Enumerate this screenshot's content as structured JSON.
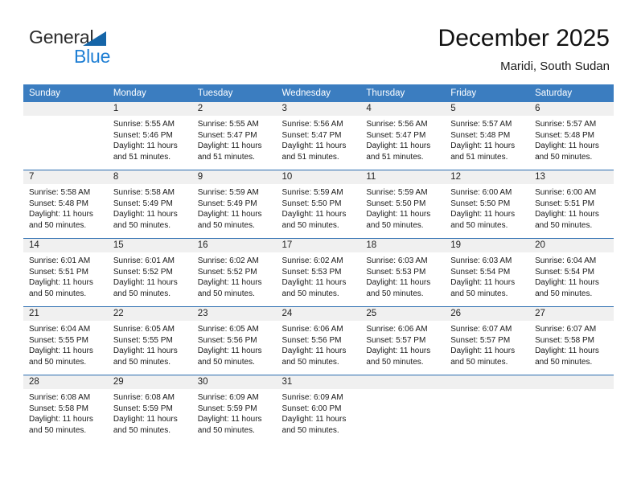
{
  "brand": {
    "name_part1": "General",
    "name_part2": "Blue",
    "flag_icon": "triangle-flag-icon"
  },
  "header": {
    "title": "December 2025",
    "subtitle": "Maridi, South Sudan"
  },
  "theme": {
    "header_blue": "#3b7dc0",
    "rule_blue": "#2a6cb0",
    "daynum_strip": "#f0f0f0",
    "brand_blue": "#1f7fd4",
    "brand_flag_blue": "#1565a8"
  },
  "calendar": {
    "weekday_headers": [
      "Sunday",
      "Monday",
      "Tuesday",
      "Wednesday",
      "Thursday",
      "Friday",
      "Saturday"
    ],
    "weeks": [
      [
        {
          "day": "",
          "sunrise": "",
          "sunset": "",
          "daylight_line1": "",
          "daylight_line2": "",
          "empty": true
        },
        {
          "day": "1",
          "sunrise": "Sunrise: 5:55 AM",
          "sunset": "Sunset: 5:46 PM",
          "daylight_line1": "Daylight: 11 hours",
          "daylight_line2": "and 51 minutes."
        },
        {
          "day": "2",
          "sunrise": "Sunrise: 5:55 AM",
          "sunset": "Sunset: 5:47 PM",
          "daylight_line1": "Daylight: 11 hours",
          "daylight_line2": "and 51 minutes."
        },
        {
          "day": "3",
          "sunrise": "Sunrise: 5:56 AM",
          "sunset": "Sunset: 5:47 PM",
          "daylight_line1": "Daylight: 11 hours",
          "daylight_line2": "and 51 minutes."
        },
        {
          "day": "4",
          "sunrise": "Sunrise: 5:56 AM",
          "sunset": "Sunset: 5:47 PM",
          "daylight_line1": "Daylight: 11 hours",
          "daylight_line2": "and 51 minutes."
        },
        {
          "day": "5",
          "sunrise": "Sunrise: 5:57 AM",
          "sunset": "Sunset: 5:48 PM",
          "daylight_line1": "Daylight: 11 hours",
          "daylight_line2": "and 51 minutes."
        },
        {
          "day": "6",
          "sunrise": "Sunrise: 5:57 AM",
          "sunset": "Sunset: 5:48 PM",
          "daylight_line1": "Daylight: 11 hours",
          "daylight_line2": "and 50 minutes."
        }
      ],
      [
        {
          "day": "7",
          "sunrise": "Sunrise: 5:58 AM",
          "sunset": "Sunset: 5:48 PM",
          "daylight_line1": "Daylight: 11 hours",
          "daylight_line2": "and 50 minutes."
        },
        {
          "day": "8",
          "sunrise": "Sunrise: 5:58 AM",
          "sunset": "Sunset: 5:49 PM",
          "daylight_line1": "Daylight: 11 hours",
          "daylight_line2": "and 50 minutes."
        },
        {
          "day": "9",
          "sunrise": "Sunrise: 5:59 AM",
          "sunset": "Sunset: 5:49 PM",
          "daylight_line1": "Daylight: 11 hours",
          "daylight_line2": "and 50 minutes."
        },
        {
          "day": "10",
          "sunrise": "Sunrise: 5:59 AM",
          "sunset": "Sunset: 5:50 PM",
          "daylight_line1": "Daylight: 11 hours",
          "daylight_line2": "and 50 minutes."
        },
        {
          "day": "11",
          "sunrise": "Sunrise: 5:59 AM",
          "sunset": "Sunset: 5:50 PM",
          "daylight_line1": "Daylight: 11 hours",
          "daylight_line2": "and 50 minutes."
        },
        {
          "day": "12",
          "sunrise": "Sunrise: 6:00 AM",
          "sunset": "Sunset: 5:50 PM",
          "daylight_line1": "Daylight: 11 hours",
          "daylight_line2": "and 50 minutes."
        },
        {
          "day": "13",
          "sunrise": "Sunrise: 6:00 AM",
          "sunset": "Sunset: 5:51 PM",
          "daylight_line1": "Daylight: 11 hours",
          "daylight_line2": "and 50 minutes."
        }
      ],
      [
        {
          "day": "14",
          "sunrise": "Sunrise: 6:01 AM",
          "sunset": "Sunset: 5:51 PM",
          "daylight_line1": "Daylight: 11 hours",
          "daylight_line2": "and 50 minutes."
        },
        {
          "day": "15",
          "sunrise": "Sunrise: 6:01 AM",
          "sunset": "Sunset: 5:52 PM",
          "daylight_line1": "Daylight: 11 hours",
          "daylight_line2": "and 50 minutes."
        },
        {
          "day": "16",
          "sunrise": "Sunrise: 6:02 AM",
          "sunset": "Sunset: 5:52 PM",
          "daylight_line1": "Daylight: 11 hours",
          "daylight_line2": "and 50 minutes."
        },
        {
          "day": "17",
          "sunrise": "Sunrise: 6:02 AM",
          "sunset": "Sunset: 5:53 PM",
          "daylight_line1": "Daylight: 11 hours",
          "daylight_line2": "and 50 minutes."
        },
        {
          "day": "18",
          "sunrise": "Sunrise: 6:03 AM",
          "sunset": "Sunset: 5:53 PM",
          "daylight_line1": "Daylight: 11 hours",
          "daylight_line2": "and 50 minutes."
        },
        {
          "day": "19",
          "sunrise": "Sunrise: 6:03 AM",
          "sunset": "Sunset: 5:54 PM",
          "daylight_line1": "Daylight: 11 hours",
          "daylight_line2": "and 50 minutes."
        },
        {
          "day": "20",
          "sunrise": "Sunrise: 6:04 AM",
          "sunset": "Sunset: 5:54 PM",
          "daylight_line1": "Daylight: 11 hours",
          "daylight_line2": "and 50 minutes."
        }
      ],
      [
        {
          "day": "21",
          "sunrise": "Sunrise: 6:04 AM",
          "sunset": "Sunset: 5:55 PM",
          "daylight_line1": "Daylight: 11 hours",
          "daylight_line2": "and 50 minutes."
        },
        {
          "day": "22",
          "sunrise": "Sunrise: 6:05 AM",
          "sunset": "Sunset: 5:55 PM",
          "daylight_line1": "Daylight: 11 hours",
          "daylight_line2": "and 50 minutes."
        },
        {
          "day": "23",
          "sunrise": "Sunrise: 6:05 AM",
          "sunset": "Sunset: 5:56 PM",
          "daylight_line1": "Daylight: 11 hours",
          "daylight_line2": "and 50 minutes."
        },
        {
          "day": "24",
          "sunrise": "Sunrise: 6:06 AM",
          "sunset": "Sunset: 5:56 PM",
          "daylight_line1": "Daylight: 11 hours",
          "daylight_line2": "and 50 minutes."
        },
        {
          "day": "25",
          "sunrise": "Sunrise: 6:06 AM",
          "sunset": "Sunset: 5:57 PM",
          "daylight_line1": "Daylight: 11 hours",
          "daylight_line2": "and 50 minutes."
        },
        {
          "day": "26",
          "sunrise": "Sunrise: 6:07 AM",
          "sunset": "Sunset: 5:57 PM",
          "daylight_line1": "Daylight: 11 hours",
          "daylight_line2": "and 50 minutes."
        },
        {
          "day": "27",
          "sunrise": "Sunrise: 6:07 AM",
          "sunset": "Sunset: 5:58 PM",
          "daylight_line1": "Daylight: 11 hours",
          "daylight_line2": "and 50 minutes."
        }
      ],
      [
        {
          "day": "28",
          "sunrise": "Sunrise: 6:08 AM",
          "sunset": "Sunset: 5:58 PM",
          "daylight_line1": "Daylight: 11 hours",
          "daylight_line2": "and 50 minutes."
        },
        {
          "day": "29",
          "sunrise": "Sunrise: 6:08 AM",
          "sunset": "Sunset: 5:59 PM",
          "daylight_line1": "Daylight: 11 hours",
          "daylight_line2": "and 50 minutes."
        },
        {
          "day": "30",
          "sunrise": "Sunrise: 6:09 AM",
          "sunset": "Sunset: 5:59 PM",
          "daylight_line1": "Daylight: 11 hours",
          "daylight_line2": "and 50 minutes."
        },
        {
          "day": "31",
          "sunrise": "Sunrise: 6:09 AM",
          "sunset": "Sunset: 6:00 PM",
          "daylight_line1": "Daylight: 11 hours",
          "daylight_line2": "and 50 minutes."
        },
        {
          "day": "",
          "sunrise": "",
          "sunset": "",
          "daylight_line1": "",
          "daylight_line2": "",
          "empty": true
        },
        {
          "day": "",
          "sunrise": "",
          "sunset": "",
          "daylight_line1": "",
          "daylight_line2": "",
          "empty": true
        },
        {
          "day": "",
          "sunrise": "",
          "sunset": "",
          "daylight_line1": "",
          "daylight_line2": "",
          "empty": true
        }
      ]
    ]
  }
}
